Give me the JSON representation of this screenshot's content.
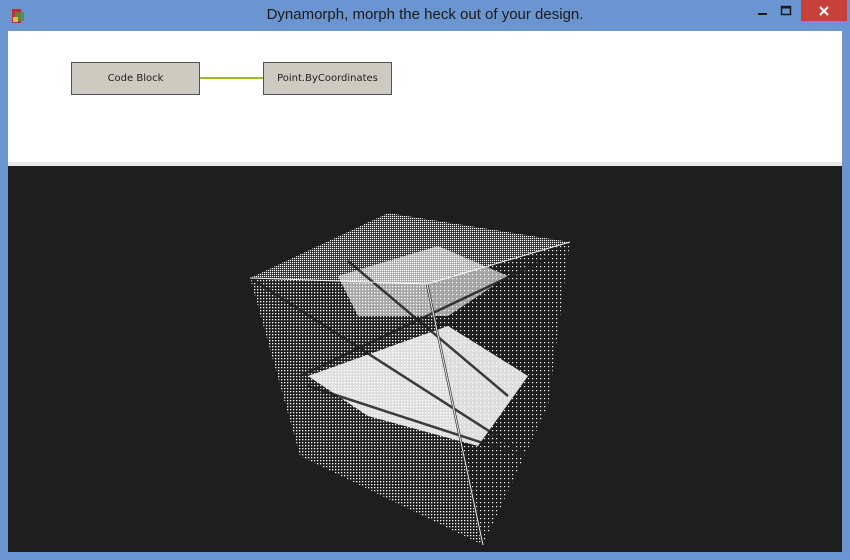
{
  "window": {
    "title": "Dynamorph, morph the heck out of your design.",
    "icon": "dynamo-app-icon",
    "controls": {
      "minimize": "minimize-icon",
      "maximize": "maximize-icon",
      "close": "close-icon"
    },
    "colors": {
      "frame": "#6b95d0",
      "close_button": "#c7413b"
    }
  },
  "graph": {
    "nodes": [
      {
        "label": "Code Block"
      },
      {
        "label": "Point.ByCoordinates"
      }
    ],
    "connector_color": "#9abf21",
    "background": "#ffffff"
  },
  "viewport": {
    "background": "#1e1e1e",
    "content": "point-cloud-cube",
    "point_color": "#ffffff"
  }
}
